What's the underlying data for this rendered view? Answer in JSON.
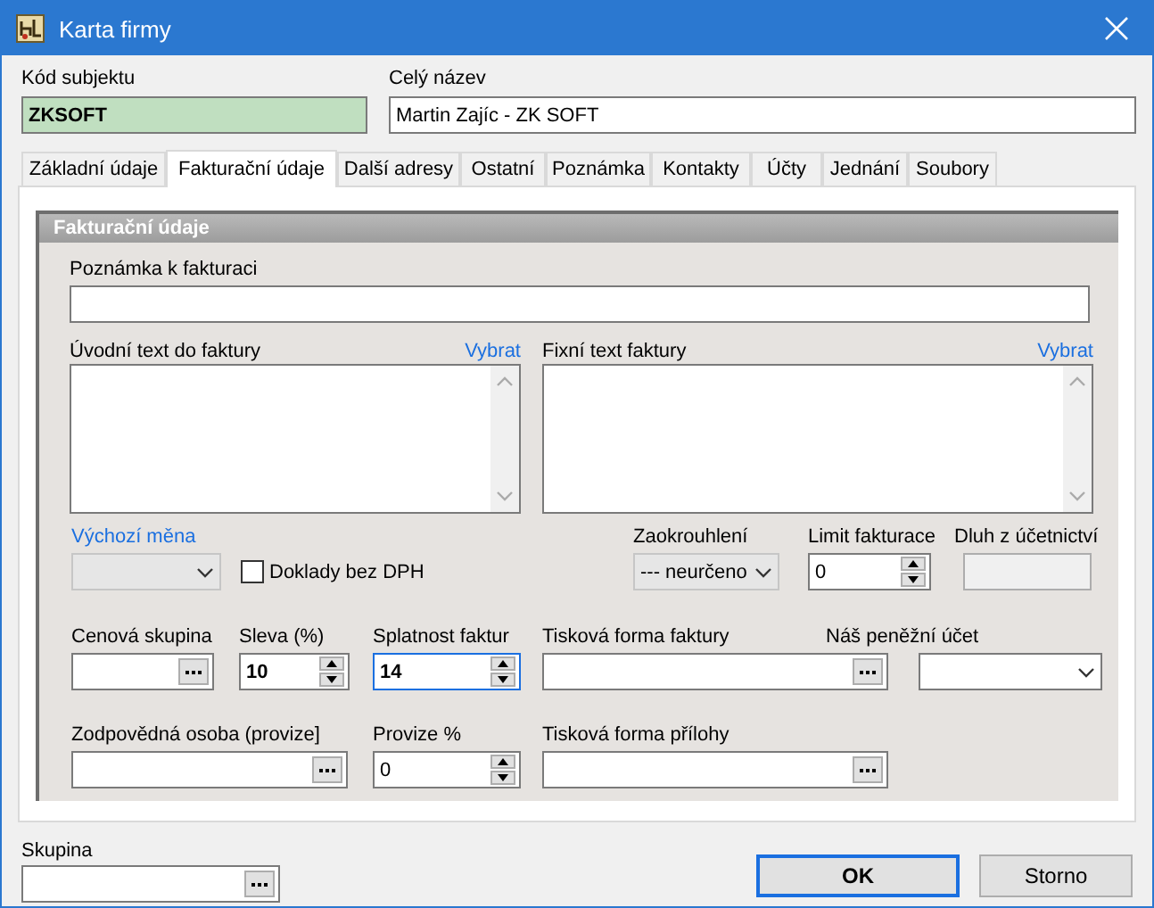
{
  "window": {
    "title": "Karta firmy"
  },
  "header": {
    "code": {
      "label": "Kód subjektu",
      "value": "ZKSOFT"
    },
    "name": {
      "label": "Celý název",
      "value": "Martin Zajíc - ZK SOFT"
    }
  },
  "tabs": [
    {
      "label": "Základní údaje",
      "selected": false
    },
    {
      "label": "Fakturační údaje",
      "selected": true
    },
    {
      "label": "Další adresy",
      "selected": false
    },
    {
      "label": "Ostatní",
      "selected": false
    },
    {
      "label": "Poznámka",
      "selected": false
    },
    {
      "label": "Kontakty",
      "selected": false
    },
    {
      "label": "Účty",
      "selected": false
    },
    {
      "label": "Jednání",
      "selected": false
    },
    {
      "label": "Soubory",
      "selected": false
    }
  ],
  "section": {
    "title": "Fakturační údaje",
    "note": {
      "label": "Poznámka k fakturaci"
    },
    "texts": [
      {
        "label": "Úvodní text do faktury",
        "link": "Vybrat"
      },
      {
        "label": "Fixní text faktury",
        "link": "Vybrat"
      }
    ],
    "field_rows": [
      {
        "fields": [
          {
            "kind": "combo",
            "label": "Výchozí měna",
            "link": true,
            "disabled": true
          },
          {
            "kind": "checkbox",
            "label": "Doklady bez DPH",
            "checked": false
          },
          {
            "kind": "combo",
            "label": "Zaokrouhlení",
            "value": "--- neurčeno",
            "disabled": true
          },
          {
            "kind": "spin",
            "label": "Limit fakturace",
            "value": "0"
          },
          {
            "kind": "readonly",
            "label": "Dluh z účetnictví"
          }
        ]
      },
      {
        "fields": [
          {
            "kind": "lookup",
            "label": "Cenová skupina"
          },
          {
            "kind": "spin",
            "label": "Sleva (%)",
            "value": "10",
            "bold": true
          },
          {
            "kind": "spin",
            "label": "Splatnost faktur",
            "value": "14",
            "bold": true,
            "focused": true
          },
          {
            "kind": "lookup",
            "label": "Tisková forma faktury"
          },
          {
            "kind": "combo",
            "label": "Náš peněžní účet",
            "disabled": false
          }
        ]
      },
      {
        "fields": [
          {
            "kind": "lookup",
            "label": "Zodpovědná osoba (provize]"
          },
          {
            "kind": "spin",
            "label": "Provize %",
            "value": "0"
          },
          {
            "kind": "lookup",
            "label": "Tisková forma přílohy"
          }
        ]
      }
    ]
  },
  "footer": {
    "group": {
      "label": "Skupina"
    },
    "buttons": [
      {
        "label": "OK",
        "default": true
      },
      {
        "label": "Storno",
        "default": false
      }
    ]
  }
}
